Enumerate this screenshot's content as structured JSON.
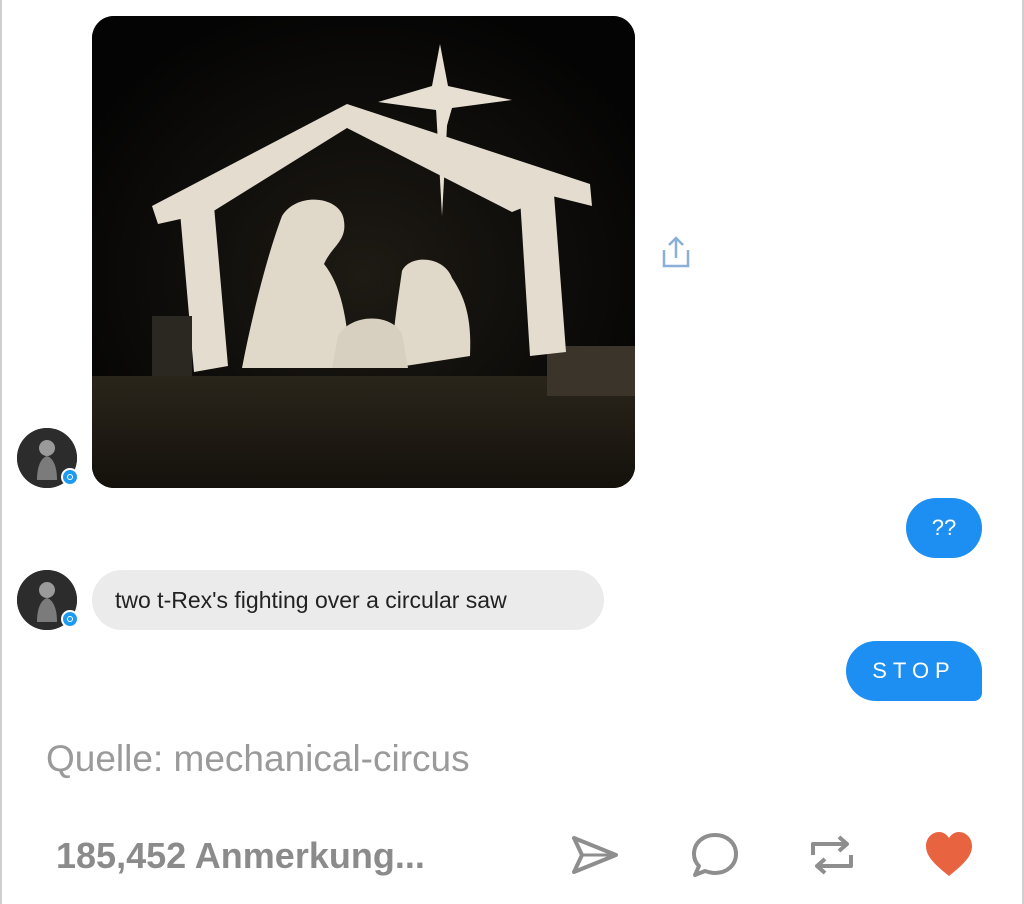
{
  "post": {
    "received_photo": {
      "alt": ""
    },
    "messages": {
      "reply_question": "??",
      "caption_message": "two t-Rex's fighting over a circular saw",
      "reply_stop": "STOP"
    },
    "source": "Quelle: mechanical-circus",
    "notes_count": "185,452 Anmerkung..."
  },
  "actions": [
    {
      "icon": "send-icon"
    },
    {
      "icon": "reply-icon"
    },
    {
      "icon": "reblog-icon"
    },
    {
      "icon": "like-heart-icon"
    }
  ],
  "colors": {
    "sent_bubble": "#1e8ff2",
    "received_bubble": "#ebebeb",
    "heart": "#e8633f",
    "icon_gray": "#8e8e8e",
    "share_icon": "#8ab0d8"
  }
}
